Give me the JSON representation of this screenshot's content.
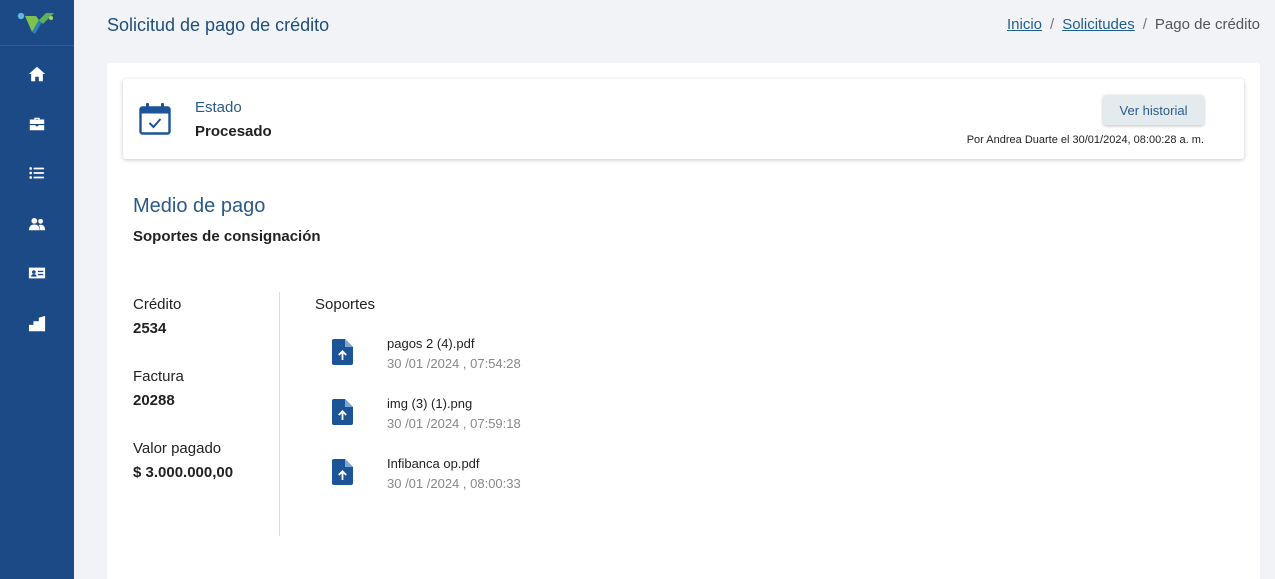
{
  "header": {
    "title": "Solicitud de pago de crédito"
  },
  "breadcrumb": {
    "home": "Inicio",
    "parent": "Solicitudes",
    "separator": "/",
    "current": "Pago de crédito"
  },
  "sidebar": {
    "icons": [
      "home-icon",
      "briefcase-icon",
      "list-icon",
      "users-icon",
      "id-card-icon",
      "building-icon"
    ]
  },
  "status": {
    "label": "Estado",
    "value": "Procesado",
    "history_button": "Ver historial",
    "by_line": "Por Andrea Duarte el 30/01/2024, 08:00:28 a. m."
  },
  "payment": {
    "title": "Medio de pago",
    "subtitle": "Soportes de consignación"
  },
  "fields": {
    "credito_label": "Crédito",
    "credito_value": "2534",
    "factura_label": "Factura",
    "factura_value": "20288",
    "valor_label": "Valor pagado",
    "valor_value": "$ 3.000.000,00"
  },
  "supports": {
    "title": "Soportes",
    "files": [
      {
        "name": "pagos 2 (4).pdf",
        "date": "30 /01 /2024 , 07:54:28"
      },
      {
        "name": "img (3) (1).png",
        "date": "30 /01 /2024 , 07:59:18"
      },
      {
        "name": "Infibanca op.pdf",
        "date": "30 /01 /2024 , 08:00:33"
      }
    ]
  },
  "colors": {
    "sidebar": "#1c4a87",
    "accent": "#2a5a8a",
    "icon": "#1c5597"
  }
}
